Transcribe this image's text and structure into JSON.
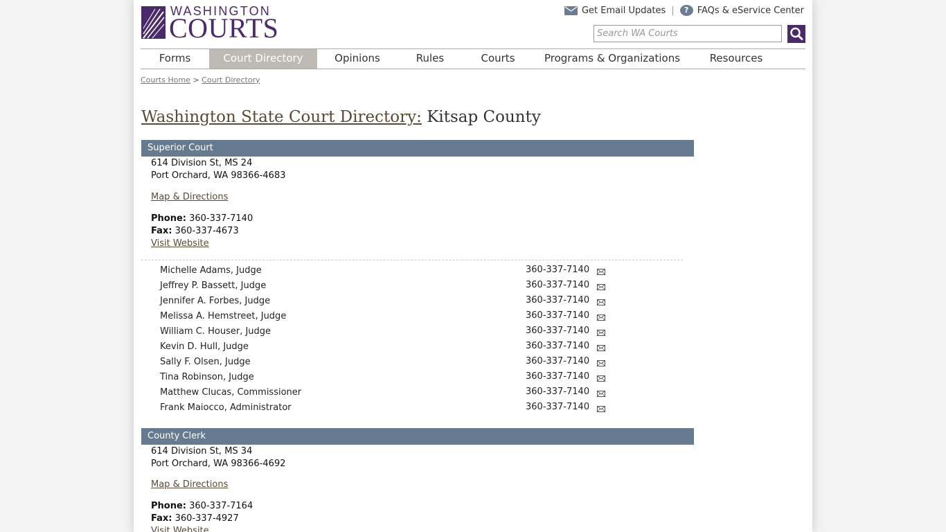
{
  "header": {
    "logo_top": "WASHINGTON",
    "logo_bottom": "COURTS",
    "email_updates": "Get Email Updates",
    "separator": "|",
    "faqs": "FAQs & eService Center",
    "search_placeholder": "Search WA Courts"
  },
  "nav": [
    {
      "label": "Forms",
      "active": false
    },
    {
      "label": "Court Directory",
      "active": true
    },
    {
      "label": "Opinions",
      "active": false
    },
    {
      "label": "Rules",
      "active": false
    },
    {
      "label": "Courts",
      "active": false
    },
    {
      "label": "Programs & Organizations",
      "active": false
    },
    {
      "label": "Resources",
      "active": false
    }
  ],
  "breadcrumb": {
    "home": "Courts Home",
    "sep": ">",
    "current": "Court Directory"
  },
  "title": {
    "link": "Washington State Court Directory:",
    "county": "Kitsap County"
  },
  "sections": [
    {
      "name": "Superior Court",
      "address1": "614 Division St, MS 24",
      "address2": "Port Orchard, WA 98366-4683",
      "map_link": "Map & Directions",
      "phone_label": "Phone:",
      "phone": "360-337-7140",
      "fax_label": "Fax:",
      "fax": "360-337-4673",
      "website": "Visit Website",
      "staff": [
        {
          "name": "Michelle Adams, Judge",
          "phone": "360-337-7140"
        },
        {
          "name": "Jeffrey P. Bassett, Judge",
          "phone": "360-337-7140"
        },
        {
          "name": "Jennifer A. Forbes, Judge",
          "phone": "360-337-7140"
        },
        {
          "name": "Melissa A. Hemstreet, Judge",
          "phone": "360-337-7140"
        },
        {
          "name": "William C. Houser, Judge",
          "phone": "360-337-7140"
        },
        {
          "name": "Kevin D. Hull, Judge",
          "phone": "360-337-7140"
        },
        {
          "name": "Sally F. Olsen, Judge",
          "phone": "360-337-7140"
        },
        {
          "name": "Tina Robinson, Judge",
          "phone": "360-337-7140"
        },
        {
          "name": "Matthew Clucas, Commissioner",
          "phone": "360-337-7140"
        },
        {
          "name": "Frank Maiocco, Administrator",
          "phone": "360-337-7140"
        }
      ]
    },
    {
      "name": "County Clerk",
      "address1": "614 Division St, MS 34",
      "address2": "Port Orchard, WA 98366-4692",
      "map_link": "Map & Directions",
      "phone_label": "Phone:",
      "phone": "360-337-7164",
      "fax_label": "Fax:",
      "fax": "360-337-4927",
      "website": "Visit Website"
    }
  ],
  "colors": {
    "brand_purple": "#4b2a6a",
    "section_header": "#667b90",
    "nav_active": "#bcbab2",
    "link": "#5a4a33"
  }
}
